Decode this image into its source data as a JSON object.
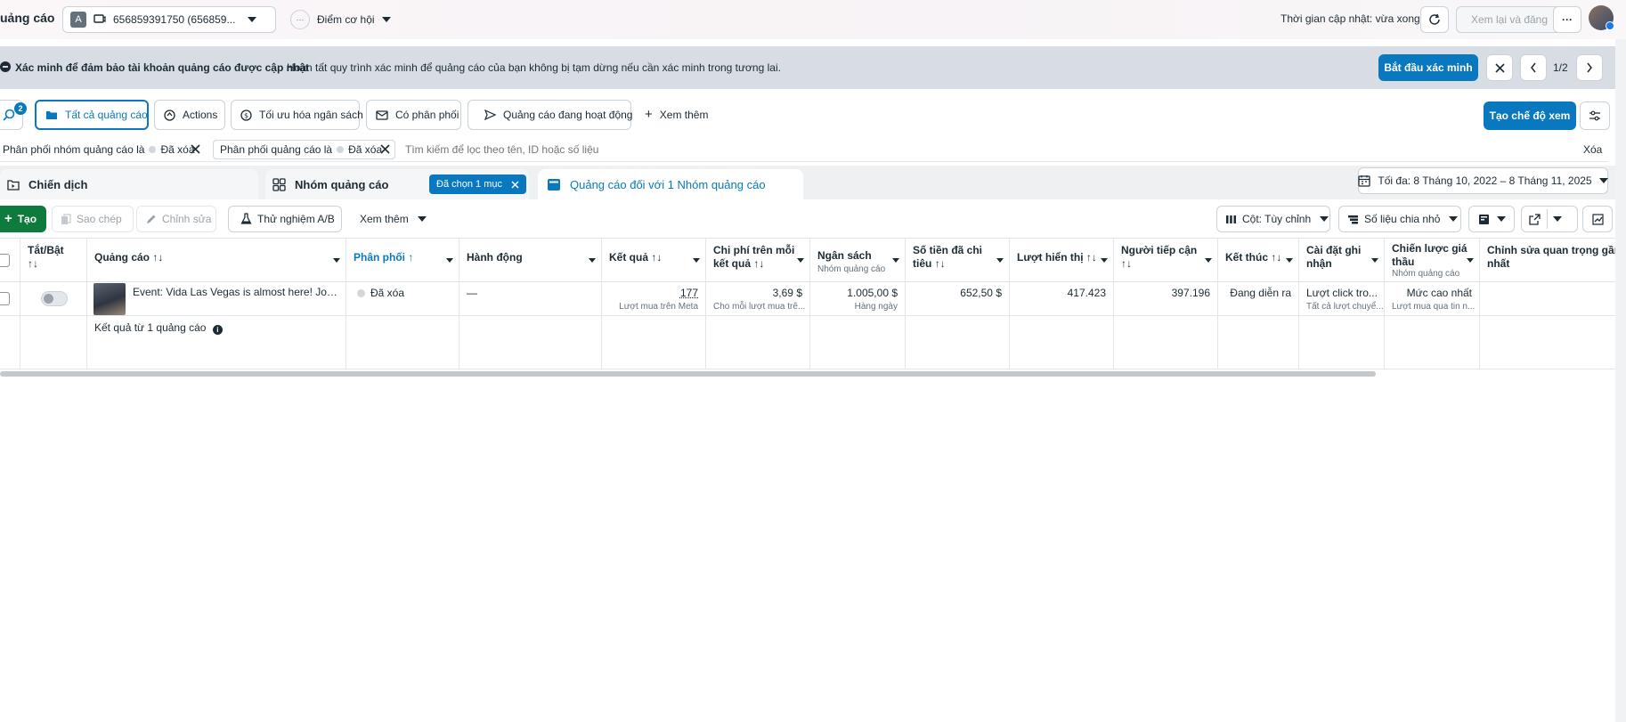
{
  "topbar": {
    "title": "uảng cáo",
    "account_badge": "A",
    "account_label": "656859391750 (656859...",
    "opportunity_label": "Điểm cơ hội",
    "update_status": "Thời gian cập nhật: vừa xong",
    "review_publish_label": "Xem lại và đăng"
  },
  "banner": {
    "title": "Xác minh để đảm bảo tài khoản quảng cáo được cập nhật",
    "message": "Hoàn tất quy trình xác minh để quảng cáo của bạn không bị tạm dừng nếu cần xác minh trong tương lai.",
    "cta_label": "Bắt đầu xác minh",
    "pager": "1/2"
  },
  "filters": {
    "search_badge": "2",
    "pills": [
      "Tất cả quảng cáo",
      "Actions",
      "Tối ưu hóa ngân sách",
      "Có phân phối",
      "Quảng cáo đang hoạt động"
    ],
    "see_more_label": "Xem thêm",
    "create_view_label": "Tạo chế độ xem"
  },
  "search": {
    "chip1_label": "Phân phối nhóm quảng cáo là",
    "chip1_value": "Đã xóa",
    "chip2_label": "Phân phối quảng cáo là",
    "chip2_value": "Đã xóa",
    "placeholder": "Tìm kiếm để lọc theo tên, ID hoặc số liệu",
    "clear_label": "Xóa"
  },
  "tabs": {
    "campaign": "Chiến dịch",
    "adset": "Nhóm quảng cáo",
    "selected_badge": "Đã chọn 1 mục",
    "ads": "Quảng cáo đối với 1 Nhóm quảng cáo",
    "date_range": "Tối đa: 8 Tháng 10, 2022 – 8 Tháng 11, 2025"
  },
  "toolbar": {
    "create": "Tạo",
    "copy": "Sao chép",
    "edit": "Chỉnh sửa",
    "ab_test": "Thử nghiệm A/B",
    "see_more": "Xem thêm",
    "columns": "Cột: Tùy chỉnh",
    "breakdown": "Số liệu chia nhỏ"
  },
  "table": {
    "headers": {
      "toggle": "Tắt/Bật",
      "ad": "Quảng cáo",
      "delivery": "Phân phối",
      "actions": "Hành động",
      "results": "Kết quả",
      "cost_per_result_1": "Chi phí trên mỗi",
      "cost_per_result_2": "kết quả",
      "budget": "Ngân sách",
      "budget_sub": "Nhóm quảng cáo",
      "amount_spent_1": "Số tiền đã chi",
      "amount_spent_2": "tiêu",
      "impressions": "Lượt hiển thị",
      "reach_1": "Người tiếp cận",
      "ends": "Kết thúc",
      "attribution_1": "Cài đặt ghi",
      "attribution_2": "nhận",
      "bid_1": "Chiến lược giá",
      "bid_2": "thầu",
      "bid_sub": "Nhóm quảng cáo",
      "last_edit_1": "Chỉnh sửa quan trọng gần đ",
      "last_edit_2": "nhất"
    },
    "row": {
      "ad_name": "Event: Vida Las Vegas is almost here! Join ...",
      "delivery": "Đã xóa",
      "actions": "—",
      "results": "177",
      "results_sub": "Lượt mua trên Meta",
      "cost_per_result": "3,69 $",
      "cost_per_result_sub": "Cho mỗi lượt mua trê...",
      "budget": "1.005,00 $",
      "budget_sub": "Hàng ngày",
      "amount_spent": "652,50 $",
      "impressions": "417.423",
      "reach": "397.196",
      "ends": "Đang diễn ra",
      "attribution": "Lượt click tro...",
      "attribution_sub": "Tất cả lượt chuyể...",
      "bid": "Mức cao nhất",
      "bid_sub": "Lượt mua qua tin n..."
    },
    "footer": "Kết quả từ 1 quảng cáo"
  },
  "colors": {
    "accent": "#0a78be",
    "create_button": "#0f7a3d",
    "banner_bg": "#d7dde2"
  }
}
